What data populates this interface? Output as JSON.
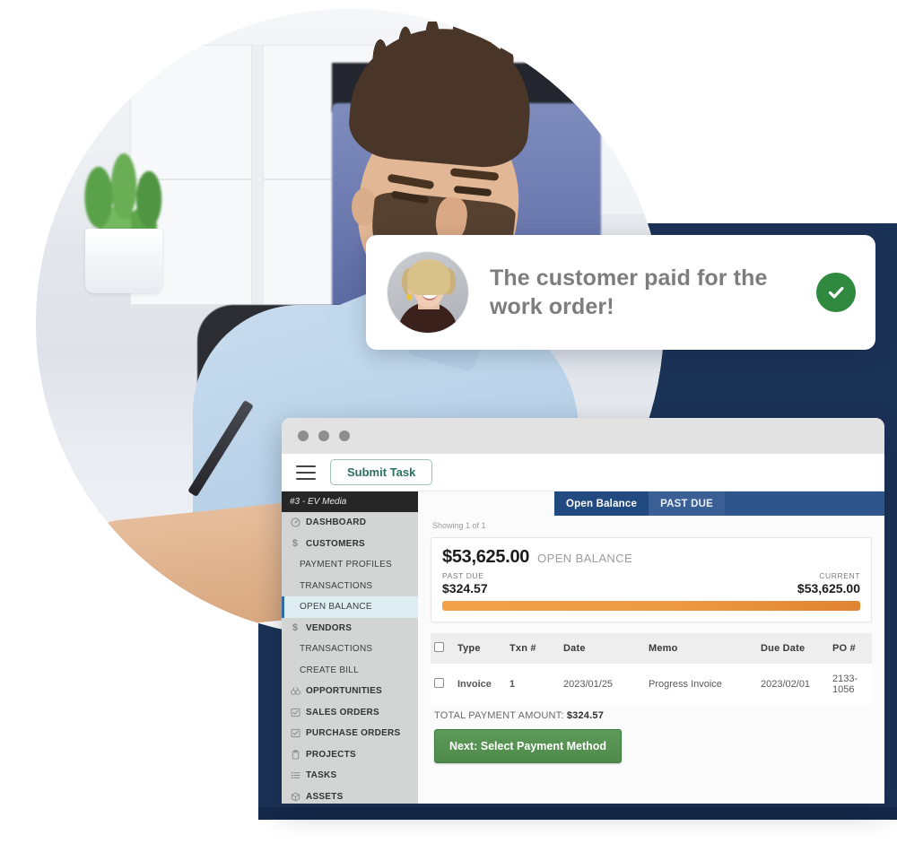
{
  "notification": {
    "message": "The customer paid for the work order!",
    "avatar_name": "customer-avatar",
    "status_icon": "check-circle-icon",
    "status_color": "#2f8a3f"
  },
  "browser": {
    "window_controls": [
      "close-dot",
      "minimize-dot",
      "maximize-dot"
    ],
    "toolbar": {
      "menu_icon": "hamburger-menu-icon",
      "submit_label": "Submit Task"
    }
  },
  "sidebar": {
    "account_label": "#3 - EV Media",
    "items": [
      {
        "label": "DASHBOARD",
        "icon": "gauge-icon",
        "level": "top",
        "active": false
      },
      {
        "label": "CUSTOMERS",
        "icon": "dollar-icon",
        "level": "top",
        "active": false
      },
      {
        "label": "PAYMENT PROFILES",
        "icon": "",
        "level": "sub",
        "active": false
      },
      {
        "label": "TRANSACTIONS",
        "icon": "",
        "level": "sub",
        "active": false
      },
      {
        "label": "OPEN BALANCE",
        "icon": "",
        "level": "sub",
        "active": true
      },
      {
        "label": "VENDORS",
        "icon": "dollar-icon",
        "level": "top",
        "active": false
      },
      {
        "label": "TRANSACTIONS",
        "icon": "",
        "level": "sub",
        "active": false
      },
      {
        "label": "CREATE BILL",
        "icon": "",
        "level": "sub",
        "active": false
      },
      {
        "label": "OPPORTUNITIES",
        "icon": "binoculars-icon",
        "level": "top",
        "active": false
      },
      {
        "label": "SALES ORDERS",
        "icon": "checkbox-icon",
        "level": "top",
        "active": false
      },
      {
        "label": "PURCHASE ORDERS",
        "icon": "checkbox-icon",
        "level": "top",
        "active": false
      },
      {
        "label": "PROJECTS",
        "icon": "clipboard-icon",
        "level": "top",
        "active": false
      },
      {
        "label": "TASKS",
        "icon": "list-icon",
        "level": "top",
        "active": false
      },
      {
        "label": "ASSETS",
        "icon": "box-icon",
        "level": "top",
        "active": false
      }
    ]
  },
  "tabs": [
    {
      "label": "Open Balance",
      "active": true
    },
    {
      "label": "PAST DUE",
      "active": false
    }
  ],
  "main": {
    "showing": "Showing 1 of 1",
    "balance": {
      "amount": "$53,625.00",
      "amount_label": "OPEN BALANCE",
      "past_due_label": "PAST DUE",
      "past_due_value": "$324.57",
      "current_label": "CURRENT",
      "current_value": "$53,625.00",
      "bar_color": "#ed9a44"
    },
    "table": {
      "columns": [
        "Type",
        "Txn #",
        "Date",
        "Memo",
        "Due Date",
        "PO #"
      ],
      "rows": [
        {
          "type": "Invoice",
          "txn": "1",
          "date": "2023/01/25",
          "memo": "Progress Invoice",
          "due_date": "2023/02/01",
          "po": "2133-1056"
        }
      ]
    },
    "total_label": "TOTAL PAYMENT AMOUNT:",
    "total_value": "$324.57",
    "next_button": "Next: Select Payment Method"
  },
  "colors": {
    "navy_backdrop": "#1b3257",
    "tab_bar": "#2e558c",
    "active_tab": "#214a80",
    "accent_green": "#4f8a4b",
    "link_blue": "#1f6fc4",
    "sidebar_bg": "#d3d4d4",
    "active_side_bg": "#deedf2"
  }
}
